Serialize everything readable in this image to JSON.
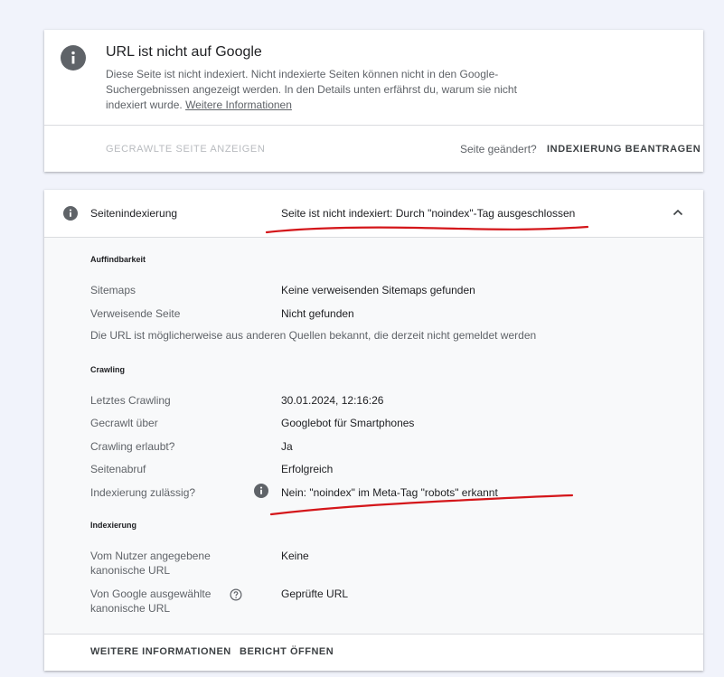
{
  "summary": {
    "title": "URL ist nicht auf Google",
    "description": "Diese Seite ist nicht indexiert. Nicht indexierte Seiten können nicht in den Google-Suchergebnissen angezeigt werden. In den Details unten erfährst du, warum sie nicht indexiert wurde.",
    "learn_more": "Weitere Informationen",
    "view_crawled_label": "GECRAWLTE SEITE ANZEIGEN",
    "page_changed_label": "Seite geändert?",
    "request_indexing_label": "INDEXIERUNG BEANTRAGEN"
  },
  "indexing": {
    "label": "Seitenindexierung",
    "status": "Seite ist nicht indexiert: Durch \"noindex\"-Tag ausgeschlossen",
    "discoverability": {
      "title": "Auffindbarkeit",
      "sitemaps_label": "Sitemaps",
      "sitemaps_value": "Keine verweisenden Sitemaps gefunden",
      "referring_label": "Verweisende Seite",
      "referring_value": "Nicht gefunden",
      "note": "Die URL ist möglicherweise aus anderen Quellen bekannt, die derzeit nicht gemeldet werden"
    },
    "crawling": {
      "title": "Crawling",
      "last_crawl_label": "Letztes Crawling",
      "last_crawl_value": "30.01.2024, 12:16:26",
      "crawled_as_label": "Gecrawlt über",
      "crawled_as_value": "Googlebot für Smartphones",
      "crawl_allowed_label": "Crawling erlaubt?",
      "crawl_allowed_value": "Ja",
      "page_fetch_label": "Seitenabruf",
      "page_fetch_value": "Erfolgreich",
      "indexing_allowed_label": "Indexierung zulässig?",
      "indexing_allowed_value": "Nein: \"noindex\" im Meta-Tag \"robots\" erkannt"
    },
    "indexierung": {
      "title": "Indexierung",
      "user_canonical_label_1": "Vom Nutzer angegebene",
      "user_canonical_label_2": "kanonische URL",
      "user_canonical_value": "Keine",
      "google_canonical_label_1": "Von Google ausgewählte",
      "google_canonical_label_2": "kanonische URL",
      "google_canonical_value": "Geprüfte URL"
    },
    "footer": {
      "more_info": "WEITERE INFORMATIONEN",
      "open_report": "BERICHT ÖFFNEN"
    }
  },
  "colors": {
    "annotation": "#d4161a",
    "icon_grey": "#5f6368",
    "background": "#f1f3fb"
  }
}
